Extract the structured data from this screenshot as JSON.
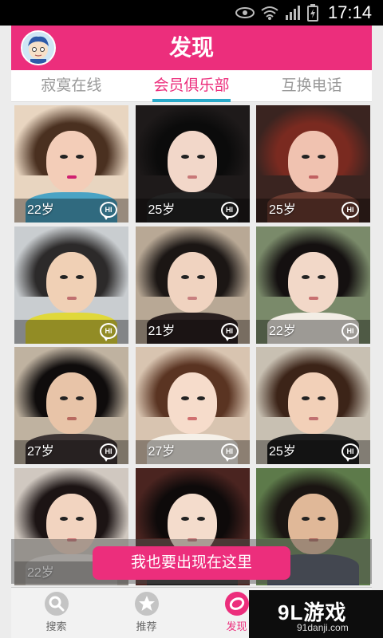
{
  "status_bar": {
    "time": "17:14"
  },
  "header": {
    "title": "发现"
  },
  "tabs": [
    {
      "label": "寂寞在线",
      "active": false
    },
    {
      "label": "会员俱乐部",
      "active": true
    },
    {
      "label": "互换电话",
      "active": false
    }
  ],
  "profiles": [
    {
      "age": "22岁",
      "hi": "HI",
      "palette": {
        "bg": "#e8d5c0",
        "hair": "#4a3020",
        "face": "#f3cdb8",
        "clothes": "#4aa3c4",
        "lips": "#d02070"
      }
    },
    {
      "age": "25岁",
      "hi": "HI",
      "palette": {
        "bg": "#1e1a1a",
        "hair": "#0b0b0b",
        "face": "#f2d7c9",
        "clothes": "#222222",
        "lips": "#c87878"
      }
    },
    {
      "age": "25岁",
      "hi": "HI",
      "palette": {
        "bg": "#3a2420",
        "hair": "#7a2a20",
        "face": "#f0c2b0",
        "clothes": "#6a3b30",
        "lips": "#c06060"
      }
    },
    {
      "age": "",
      "hi": "HI",
      "palette": {
        "bg": "#c9cdd0",
        "hair": "#2c2a2a",
        "face": "#f0d0b5",
        "clothes": "#e0d83a",
        "lips": "#c07070"
      }
    },
    {
      "age": "21岁",
      "hi": "HI",
      "palette": {
        "bg": "#b8a895",
        "hair": "#1b1614",
        "face": "#f0d3c0",
        "clothes": "#2a2020",
        "lips": "#c88080"
      }
    },
    {
      "age": "22岁",
      "hi": "HI",
      "palette": {
        "bg": "#7a8a6a",
        "hair": "#141010",
        "face": "#f2d8c8",
        "clothes": "#f2ede5",
        "lips": "#c87070"
      }
    },
    {
      "age": "27岁",
      "hi": "HI",
      "palette": {
        "bg": "#bfb2a0",
        "hair": "#0f0c0c",
        "face": "#e8c4a8",
        "clothes": "#3c3434",
        "lips": "#b86a60"
      }
    },
    {
      "age": "27岁",
      "hi": "HI",
      "palette": {
        "bg": "#d8c4b0",
        "hair": "#5a3422",
        "face": "#f6dccb",
        "clothes": "#f5f0e8",
        "lips": "#d07070"
      }
    },
    {
      "age": "25岁",
      "hi": "HI",
      "palette": {
        "bg": "#c8c0b2",
        "hair": "#3c2418",
        "face": "#f2d0b8",
        "clothes": "#1e1e1e",
        "lips": "#c07070"
      }
    },
    {
      "age": "22岁",
      "hi": "",
      "palette": {
        "bg": "#d0c8c0",
        "hair": "#1c1414",
        "face": "#f2d4c0",
        "clothes": "#e9e4df",
        "lips": "#d07878"
      }
    },
    {
      "age": "",
      "hi": "",
      "palette": {
        "bg": "#4a2420",
        "hair": "#0e0a0a",
        "face": "#f4dccc",
        "clothes": "#222222",
        "lips": "#c87878"
      }
    },
    {
      "age": "",
      "hi": "",
      "palette": {
        "bg": "#5d7a4a",
        "hair": "#1a1512",
        "face": "#e0b898",
        "clothes": "#3a4050",
        "lips": "#b06a60"
      }
    }
  ],
  "cta": {
    "label": "我也要出现在这里"
  },
  "bottom_nav": [
    {
      "label": "搜索",
      "icon": "search-icon",
      "active": false
    },
    {
      "label": "推荐",
      "icon": "star-icon",
      "active": false
    },
    {
      "label": "发现",
      "icon": "discover-icon",
      "active": true
    },
    {
      "label": "",
      "icon": "more-icon",
      "active": false
    }
  ],
  "watermark": {
    "logo": "9L游戏",
    "url": "91danji.com"
  },
  "colors": {
    "accent": "#ec2e7c",
    "tab_indicator": "#2aa9c9"
  }
}
